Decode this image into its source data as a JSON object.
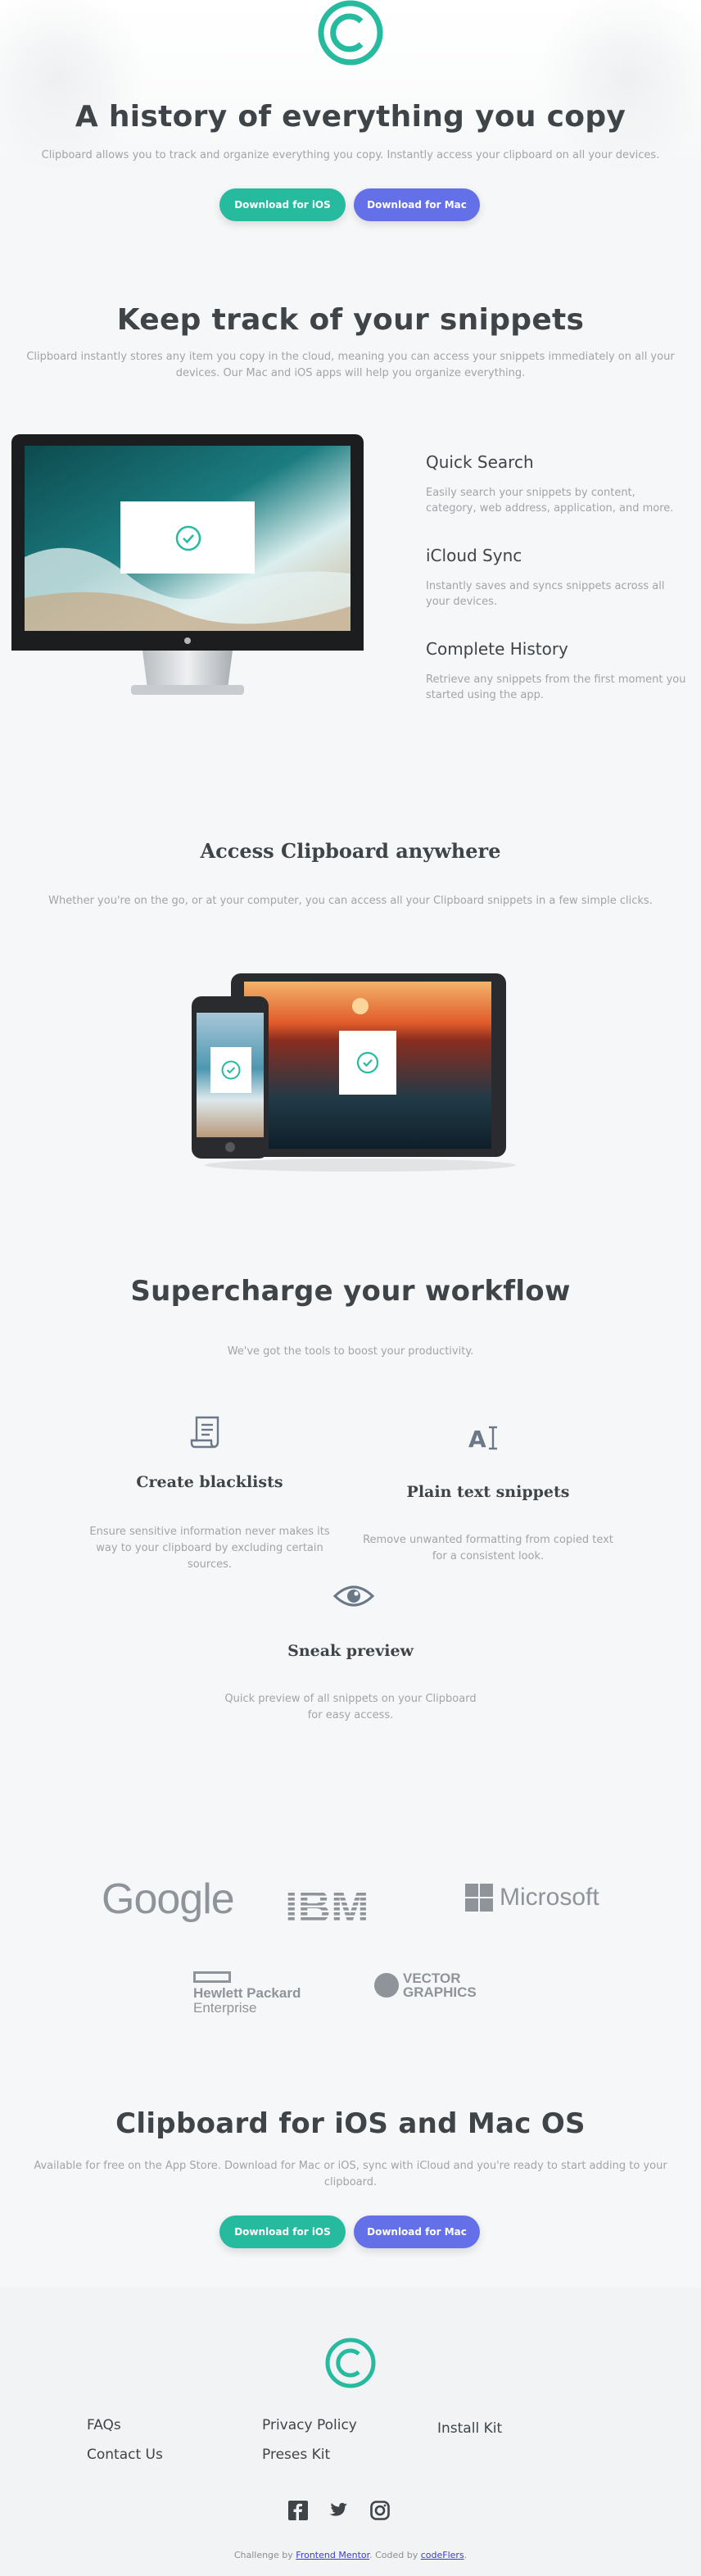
{
  "hero": {
    "title": "A history of everything you copy",
    "subtitle": "Clipboard allows you to track and organize everything you copy. Instantly access your clipboard on all your devices.",
    "btn_ios": "Download for iOS",
    "btn_mac": "Download for Mac"
  },
  "snippets": {
    "title": "Keep track of your snippets",
    "subtitle": "Clipboard instantly stores any item you copy in the cloud, meaning you can access your snippets immediately on all your devices. Our Mac and iOS apps will help you organize everything.",
    "features": [
      {
        "title": "Quick Search",
        "text": "Easily search your snippets by content, category, web address, application, and more."
      },
      {
        "title": "iCloud Sync",
        "text": "Instantly saves and syncs snippets across all your devices."
      },
      {
        "title": "Complete History",
        "text": "Retrieve any snippets from the first moment you started using the app."
      }
    ]
  },
  "access": {
    "title": "Access Clipboard anywhere",
    "subtitle": "Whether you're on the go, or at your computer, you can access all your Clipboard snippets in a few simple clicks."
  },
  "workflow": {
    "title": "Supercharge your workflow",
    "subtitle": "We've got the tools to boost your productivity.",
    "cards": [
      {
        "title": "Create blacklists",
        "text": "Ensure sensitive information never makes its way to your clipboard by excluding certain sources."
      },
      {
        "title": "Plain text snippets",
        "text": "Remove unwanted formatting from copied text for a consistent look."
      },
      {
        "title": "Sneak preview",
        "text": "Quick preview of all snippets on your Clipboard for easy access."
      }
    ]
  },
  "logos": {
    "google": "Google",
    "ibm": "IBM",
    "microsoft": "Microsoft",
    "hpe_line1": "Hewlett Packard",
    "hpe_line2": "Enterprise",
    "vector_line1": "VECTOR",
    "vector_line2": "GRAPHICS"
  },
  "cta": {
    "title": "Clipboard for iOS and Mac OS",
    "subtitle": "Available for free on the App Store. Download for Mac or iOS, sync with iCloud and you're ready to start adding to your clipboard.",
    "btn_ios": "Download for iOS",
    "btn_mac": "Download for Mac"
  },
  "footer": {
    "links": [
      "FAQs",
      "Contact Us",
      "Privacy Policy",
      "Preses Kit",
      "Install Kit"
    ],
    "attribution_prefix": "Challenge by",
    "attribution_fm": "Frontend Mentor",
    "attribution_mid": ". Coded by",
    "attribution_author": "codeFlers",
    "attribution_suffix": "."
  },
  "colors": {
    "accent_teal": "#26ba9f",
    "accent_blue": "#6370e8",
    "heading": "#3f4449",
    "body_text": "#a1a4a8"
  },
  "icons": [
    "clipboard-logo-icon",
    "checkmark-icon",
    "blacklist-icon",
    "text-cursor-icon",
    "eye-icon",
    "facebook-icon",
    "twitter-icon",
    "instagram-icon"
  ]
}
